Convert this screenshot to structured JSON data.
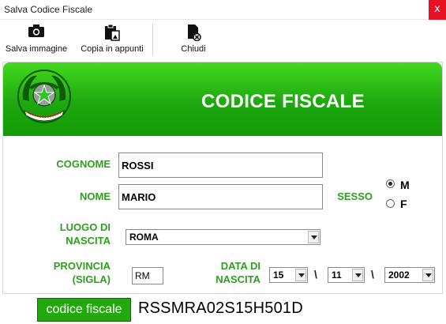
{
  "window": {
    "title": "Salva Codice Fiscale",
    "close_glyph": "x"
  },
  "toolbar": {
    "save_image": {
      "label": "Salva immagine",
      "icon": "camera-icon"
    },
    "copy": {
      "label": "Copia in appunti",
      "icon": "clipboard-icon"
    },
    "close": {
      "label": "Chiudi",
      "icon": "close-document-icon"
    }
  },
  "banner": {
    "title": "CODICE FISCALE",
    "emblem_text": "REPUBBLICA ITALIANA"
  },
  "form": {
    "cognome": {
      "label": "COGNOME",
      "value": "ROSSI"
    },
    "nome": {
      "label": "NOME",
      "value": "MARIO"
    },
    "sesso": {
      "label": "SESSO",
      "options": [
        "M",
        "F"
      ],
      "selected": "M"
    },
    "luogo": {
      "label_line1": "LUOGO DI",
      "label_line2": "NASCITA",
      "value": "ROMA"
    },
    "provincia": {
      "label_line1": "PROVINCIA",
      "label_line2": "(SIGLA)",
      "value": "RM"
    },
    "data": {
      "label_line1": "DATA DI",
      "label_line2": "NASCITA",
      "day": "15",
      "month": "11",
      "year": "2002",
      "separator": "\\"
    }
  },
  "result": {
    "button_label": "codice fiscale",
    "code": "RSSMRA02S15H501D"
  },
  "colors": {
    "green_label": "#2e9e1f",
    "banner_green": "#1ea80f",
    "button_green": "#23a80f",
    "close_red": "#e81123"
  }
}
